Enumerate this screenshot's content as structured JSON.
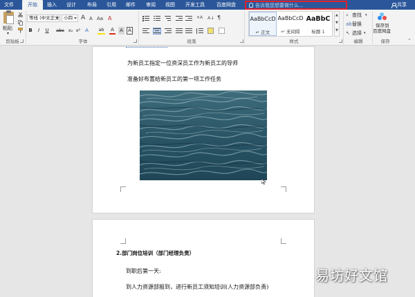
{
  "tabs": [
    "文件",
    "开始",
    "插入",
    "设计",
    "布局",
    "引用",
    "邮件",
    "审阅",
    "视图",
    "开发工具",
    "百度网盘"
  ],
  "active_tab": "开始",
  "tell_me": {
    "placeholder": "告诉我您想要做什么..."
  },
  "share_label": "共享",
  "ribbon": {
    "clipboard": {
      "paste_label": "粘贴",
      "group_label": "剪贴板"
    },
    "font": {
      "font_name": "等线 (中文正文)",
      "font_size": "小四",
      "grow_label": "A",
      "shrink_label": "A",
      "case_label": "Aa",
      "clear_label": "A",
      "bold": "B",
      "italic": "I",
      "underline": "U",
      "strike": "abc",
      "sub": "x₂",
      "sup": "x²",
      "effects": "A",
      "highlight": "ab",
      "color": "A",
      "shade": "A",
      "border": "A",
      "group_label": "字体"
    },
    "paragraph": {
      "group_label": "段落"
    },
    "styles": {
      "items": [
        {
          "preview": "AaBbCcD",
          "name": "↵ 正文"
        },
        {
          "preview": "AaBbCcD",
          "name": "↵ 无间隔"
        },
        {
          "preview": "AaBbC",
          "name": "标题 1"
        }
      ],
      "group_label": "样式"
    },
    "editing": {
      "find": "查找",
      "replace": "替换",
      "select": "选择",
      "group_label": "编辑"
    },
    "save": {
      "label_line1": "保存到",
      "label_line2": "百度网盘",
      "group_label": "保存"
    }
  },
  "document": {
    "page1": {
      "line1": "为新员工指定一位资深员工作为新员工的导师",
      "line2": "准备好布置给新员工的第一项工作任务"
    },
    "page2": {
      "heading": "2.部门岗位培训（部门经理负责）",
      "line1": "到职后第一天:",
      "line2": "到人力资源部报到，进行新员工须知培训(人力资源部负责)"
    }
  },
  "watermark": "易坊好文馆",
  "colors": {
    "ribbon_blue": "#2b579a",
    "highlight_red": "#e2222b"
  }
}
